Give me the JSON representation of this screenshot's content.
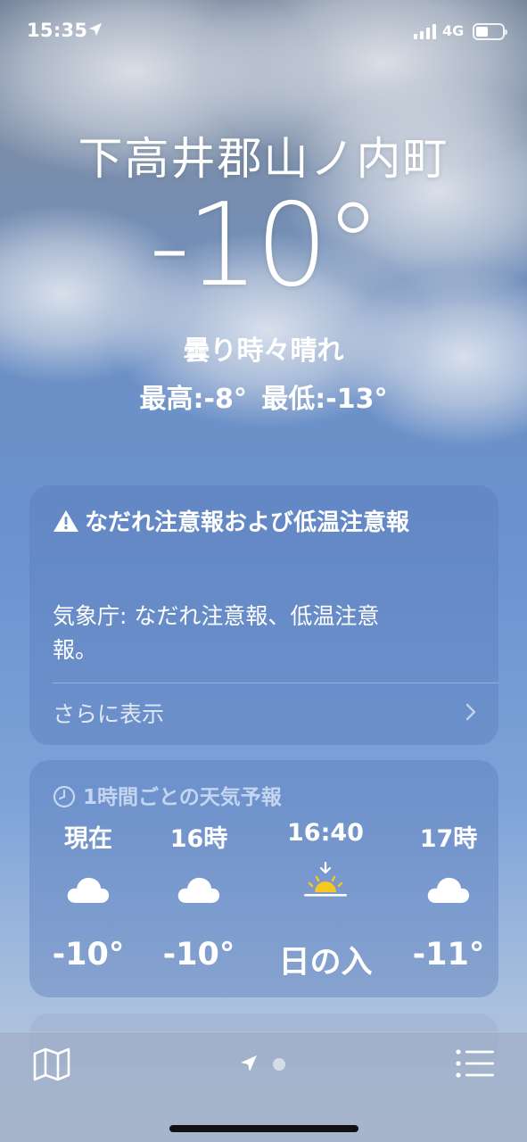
{
  "status_bar": {
    "time": "15:35",
    "network": "4G",
    "location_icon": "location-arrow-icon",
    "battery_level": 0.45
  },
  "location": {
    "city": "下高井郡山ノ内町",
    "temperature": "-10°",
    "condition": "曇り時々晴れ",
    "high_low": "最高:-8°  最低:-13°"
  },
  "alert": {
    "icon": "warning-triangle-icon",
    "title": "なだれ注意報および低温注意報",
    "body": "気象庁: なだれ注意報、低温注意報。",
    "more_label": "さらに表示"
  },
  "hourly": {
    "header": "1時間ごとの天気予報",
    "items": [
      {
        "label": "現在",
        "icon": "cloud-icon",
        "value": "-10°"
      },
      {
        "label": "16時",
        "icon": "cloud-icon",
        "value": "-10°"
      },
      {
        "label": "16:40",
        "icon": "sunset-icon",
        "value": "日の入"
      },
      {
        "label": "17時",
        "icon": "cloud-icon",
        "value": "-11°"
      }
    ]
  },
  "bottom_bar": {
    "map_icon": "map-icon",
    "location_icon": "location-arrow-icon",
    "list_icon": "list-icon"
  }
}
